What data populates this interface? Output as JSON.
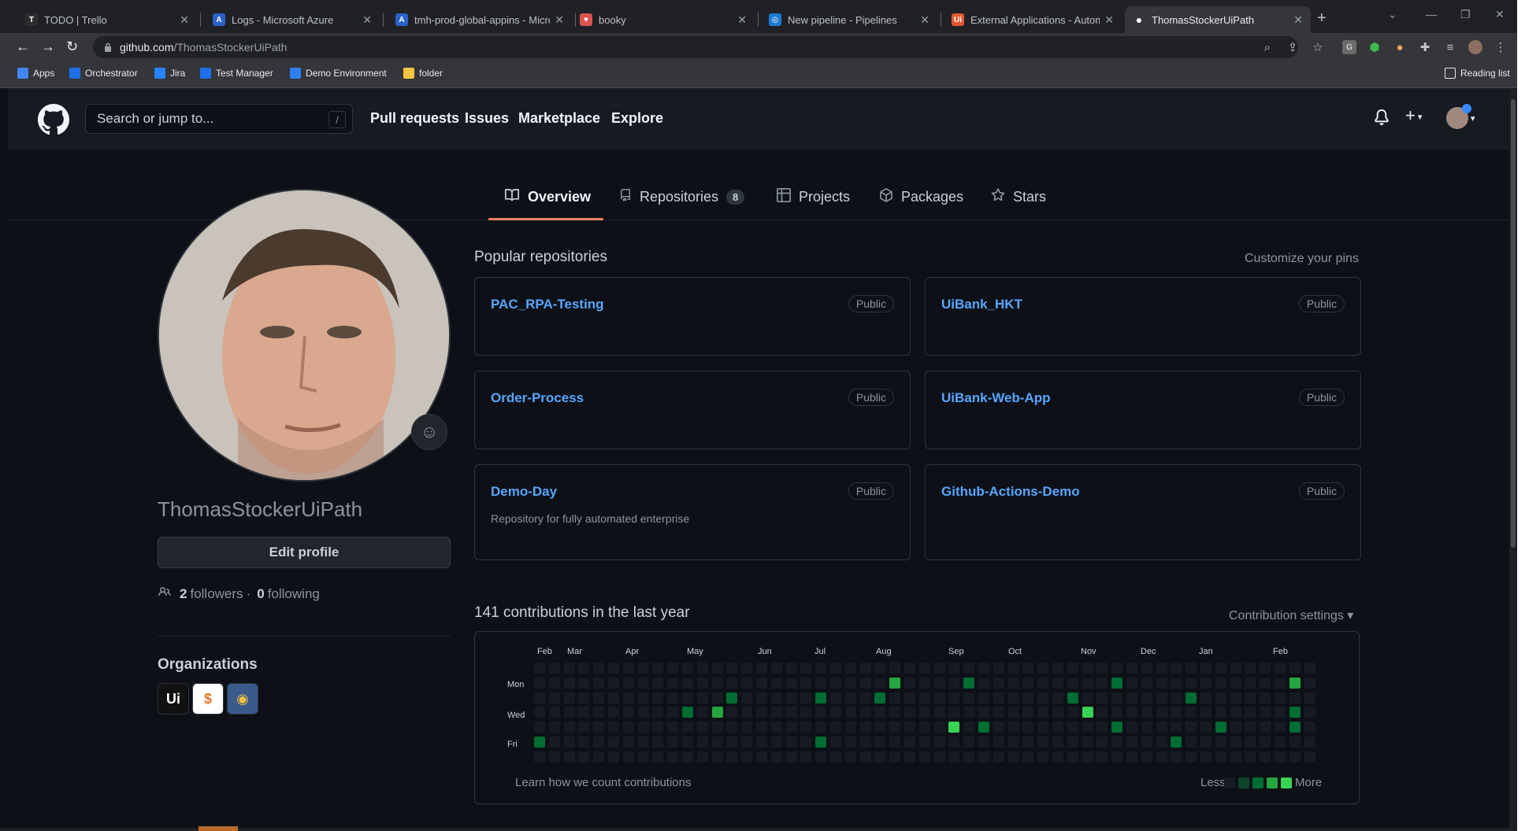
{
  "browser": {
    "tabs": [
      {
        "title": "TODO | Trello",
        "favicon_color": "#2d2d2d",
        "favicon_glyph": "T"
      },
      {
        "title": "Logs - Microsoft Azure",
        "favicon_color": "#2a62c9",
        "favicon_glyph": "A"
      },
      {
        "title": "tmh-prod-global-appins - Micro",
        "favicon_color": "#2a62c9",
        "favicon_glyph": "A"
      },
      {
        "title": "booky",
        "favicon_color": "#d9534f",
        "favicon_glyph": "♥"
      },
      {
        "title": "New pipeline - Pipelines",
        "favicon_color": "#1f7ad6",
        "favicon_glyph": "◎"
      },
      {
        "title": "External Applications - Automat",
        "favicon_color": "#e4572e",
        "favicon_glyph": "Ui"
      },
      {
        "title": "ThomasStockerUiPath",
        "favicon_color": "#ffffff",
        "favicon_glyph": "●"
      }
    ],
    "url_host": "github.com",
    "url_path": "/ThomasStockerUiPath",
    "bookmarks": [
      {
        "label": "Apps",
        "color": "#4285f4"
      },
      {
        "label": "Orchestrator",
        "color": "#1f6feb"
      },
      {
        "label": "Jira",
        "color": "#2684ff"
      },
      {
        "label": "Test Manager",
        "color": "#1f6feb"
      },
      {
        "label": "Demo Environment",
        "color": "#2f80ed"
      },
      {
        "label": "folder",
        "color": "#f6c343"
      }
    ],
    "reading_list": "Reading list"
  },
  "github": {
    "search_placeholder": "Search or jump to...",
    "search_shortcut": "/",
    "nav": [
      "Pull requests",
      "Issues",
      "Marketplace",
      "Explore"
    ],
    "profile_tabs": [
      {
        "label": "Overview",
        "icon": "book-icon"
      },
      {
        "label": "Repositories",
        "icon": "repo-icon",
        "count": "8"
      },
      {
        "label": "Projects",
        "icon": "table-icon"
      },
      {
        "label": "Packages",
        "icon": "package-icon"
      },
      {
        "label": "Stars",
        "icon": "star-icon"
      }
    ],
    "username": "ThomasStockerUiPath",
    "edit_profile": "Edit profile",
    "followers_count": "2",
    "followers_label": "followers",
    "following_count": "0",
    "following_label": "following",
    "dot": "·",
    "organizations_title": "Organizations",
    "organizations": [
      {
        "label": "Ui",
        "bg": "#111111",
        "fg": "#ffffff"
      },
      {
        "label": "$",
        "bg": "#ffffff",
        "fg": "#f4731f"
      },
      {
        "label": "◉",
        "bg": "#3a5a8c",
        "fg": "#f0c040"
      }
    ],
    "popular_title": "Popular repositories",
    "customize_pins": "Customize your pins",
    "pins": [
      {
        "name": "PAC_RPA-Testing",
        "visibility": "Public",
        "description": ""
      },
      {
        "name": "UiBank_HKT",
        "visibility": "Public",
        "description": ""
      },
      {
        "name": "Order-Process",
        "visibility": "Public",
        "description": ""
      },
      {
        "name": "UiBank-Web-App",
        "visibility": "Public",
        "description": ""
      },
      {
        "name": "Demo-Day",
        "visibility": "Public",
        "description": "Repository for fully automated enterprise"
      },
      {
        "name": "Github-Actions-Demo",
        "visibility": "Public",
        "description": ""
      }
    ],
    "contrib_title": "141 contributions in the last year",
    "contrib_settings": "Contribution settings ▾",
    "months": [
      "Feb",
      "Mar",
      "Apr",
      "May",
      "Jun",
      "Jul",
      "Aug",
      "Sep",
      "Oct",
      "Nov",
      "Dec",
      "Jan",
      "Feb"
    ],
    "day_labels": [
      "Mon",
      "Wed",
      "Fri"
    ],
    "learn_link": "Learn how we count contributions",
    "legend_less": "Less",
    "legend_more": "More",
    "colors": {
      "level0": "#161b22",
      "level1": "#0e4429",
      "level2": "#006d32",
      "level3": "#26a641",
      "level4": "#39d353",
      "accent_tab": "#f78166",
      "link": "#58a6ff"
    }
  }
}
